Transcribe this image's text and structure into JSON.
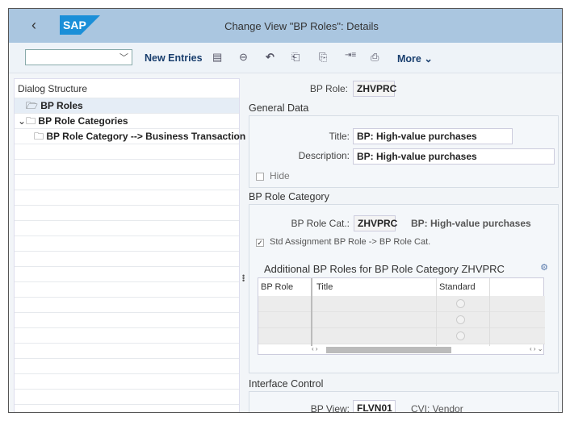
{
  "header": {
    "title": "Change View \"BP Roles\": Details",
    "back_icon": "chevron-left-icon",
    "logo": "SAP"
  },
  "toolbar": {
    "command_value": "",
    "new_entries": "New Entries",
    "more": "More",
    "icons": [
      "copy-icon",
      "delete-icon",
      "undo-icon",
      "previous-entry-icon",
      "next-entry-icon",
      "transport-icon",
      "print-icon"
    ]
  },
  "tree": {
    "title": "Dialog Structure",
    "items": [
      {
        "label": "BP Roles",
        "selected": true
      },
      {
        "label": "BP Role Categories",
        "expanded": true
      },
      {
        "label": "BP Role Category --> Business Transaction"
      }
    ]
  },
  "detail": {
    "bp_role_label": "BP Role:",
    "bp_role": "ZHVPRC",
    "general": {
      "heading": "General Data",
      "title_label": "Title:",
      "title": "BP: High-value purchases",
      "desc_label": "Description:",
      "desc": "BP: High-value purchases",
      "hide_label": "Hide",
      "hide_checked": false
    },
    "category": {
      "heading": "BP Role Category",
      "cat_label": "BP Role Cat.:",
      "cat": "ZHVPRC",
      "cat_text": "BP: High-value purchases",
      "std_label": "Std Assignment BP Role -> BP Role Cat.",
      "std_checked": true
    },
    "additional": {
      "heading": "Additional BP Roles for BP Role Category ZHVPRC",
      "columns": [
        "BP Role",
        "Title",
        "Standard"
      ],
      "rows": [
        {
          "role": "",
          "title": "",
          "standard": false
        },
        {
          "role": "",
          "title": "",
          "standard": false
        },
        {
          "role": "",
          "title": "",
          "standard": false
        }
      ]
    },
    "interface": {
      "heading": "Interface Control",
      "view_label": "BP View:",
      "view": "FLVN01",
      "view_text": "CVI: Vendor"
    }
  },
  "colors": {
    "header": "#aac6e0",
    "logo": "#1b8fd8",
    "link": "#1a3f6e"
  }
}
